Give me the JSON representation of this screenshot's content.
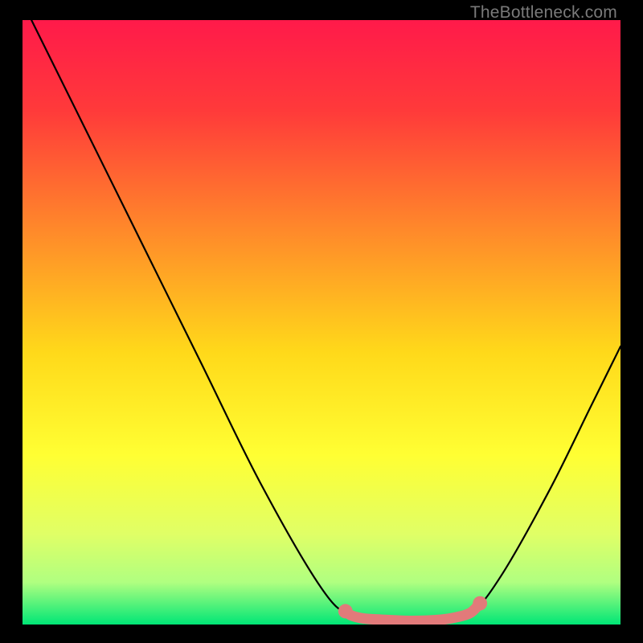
{
  "watermark": "TheBottleneck.com",
  "chart_data": {
    "type": "line",
    "title": "",
    "xlabel": "",
    "ylabel": "",
    "xlim": [
      0,
      100
    ],
    "ylim": [
      0,
      100
    ],
    "gradient_stops": [
      {
        "offset": 0,
        "color": "#ff1a4a"
      },
      {
        "offset": 15,
        "color": "#ff3a3a"
      },
      {
        "offset": 35,
        "color": "#ff8a2a"
      },
      {
        "offset": 55,
        "color": "#ffd91a"
      },
      {
        "offset": 72,
        "color": "#ffff33"
      },
      {
        "offset": 85,
        "color": "#e0ff66"
      },
      {
        "offset": 93,
        "color": "#b0ff80"
      },
      {
        "offset": 100,
        "color": "#00e676"
      }
    ],
    "series": [
      {
        "name": "bottleneck-curve",
        "color": "#000000",
        "points": [
          {
            "x": 1.5,
            "y": 100.0
          },
          {
            "x": 10.0,
            "y": 83.0
          },
          {
            "x": 20.0,
            "y": 63.0
          },
          {
            "x": 30.0,
            "y": 43.0
          },
          {
            "x": 40.0,
            "y": 23.0
          },
          {
            "x": 50.0,
            "y": 6.0
          },
          {
            "x": 55.0,
            "y": 1.5
          },
          {
            "x": 60.0,
            "y": 0.8
          },
          {
            "x": 65.0,
            "y": 0.6
          },
          {
            "x": 70.0,
            "y": 0.8
          },
          {
            "x": 75.0,
            "y": 2.0
          },
          {
            "x": 80.0,
            "y": 8.0
          },
          {
            "x": 88.0,
            "y": 22.0
          },
          {
            "x": 95.0,
            "y": 36.0
          },
          {
            "x": 100.0,
            "y": 46.0
          }
        ]
      },
      {
        "name": "optimal-range-highlight",
        "color": "#e27a7a",
        "thick": true,
        "points": [
          {
            "x": 54.0,
            "y": 2.2
          },
          {
            "x": 55.0,
            "y": 1.5
          },
          {
            "x": 57.0,
            "y": 1.0
          },
          {
            "x": 60.0,
            "y": 0.8
          },
          {
            "x": 65.0,
            "y": 0.6
          },
          {
            "x": 70.0,
            "y": 0.8
          },
          {
            "x": 73.0,
            "y": 1.3
          },
          {
            "x": 75.0,
            "y": 2.0
          },
          {
            "x": 76.5,
            "y": 3.5
          }
        ]
      }
    ],
    "markers": [
      {
        "x": 54.0,
        "y": 2.2,
        "r": 1.2,
        "color": "#e27a7a"
      },
      {
        "x": 76.5,
        "y": 3.5,
        "r": 1.2,
        "color": "#e27a7a"
      }
    ]
  }
}
